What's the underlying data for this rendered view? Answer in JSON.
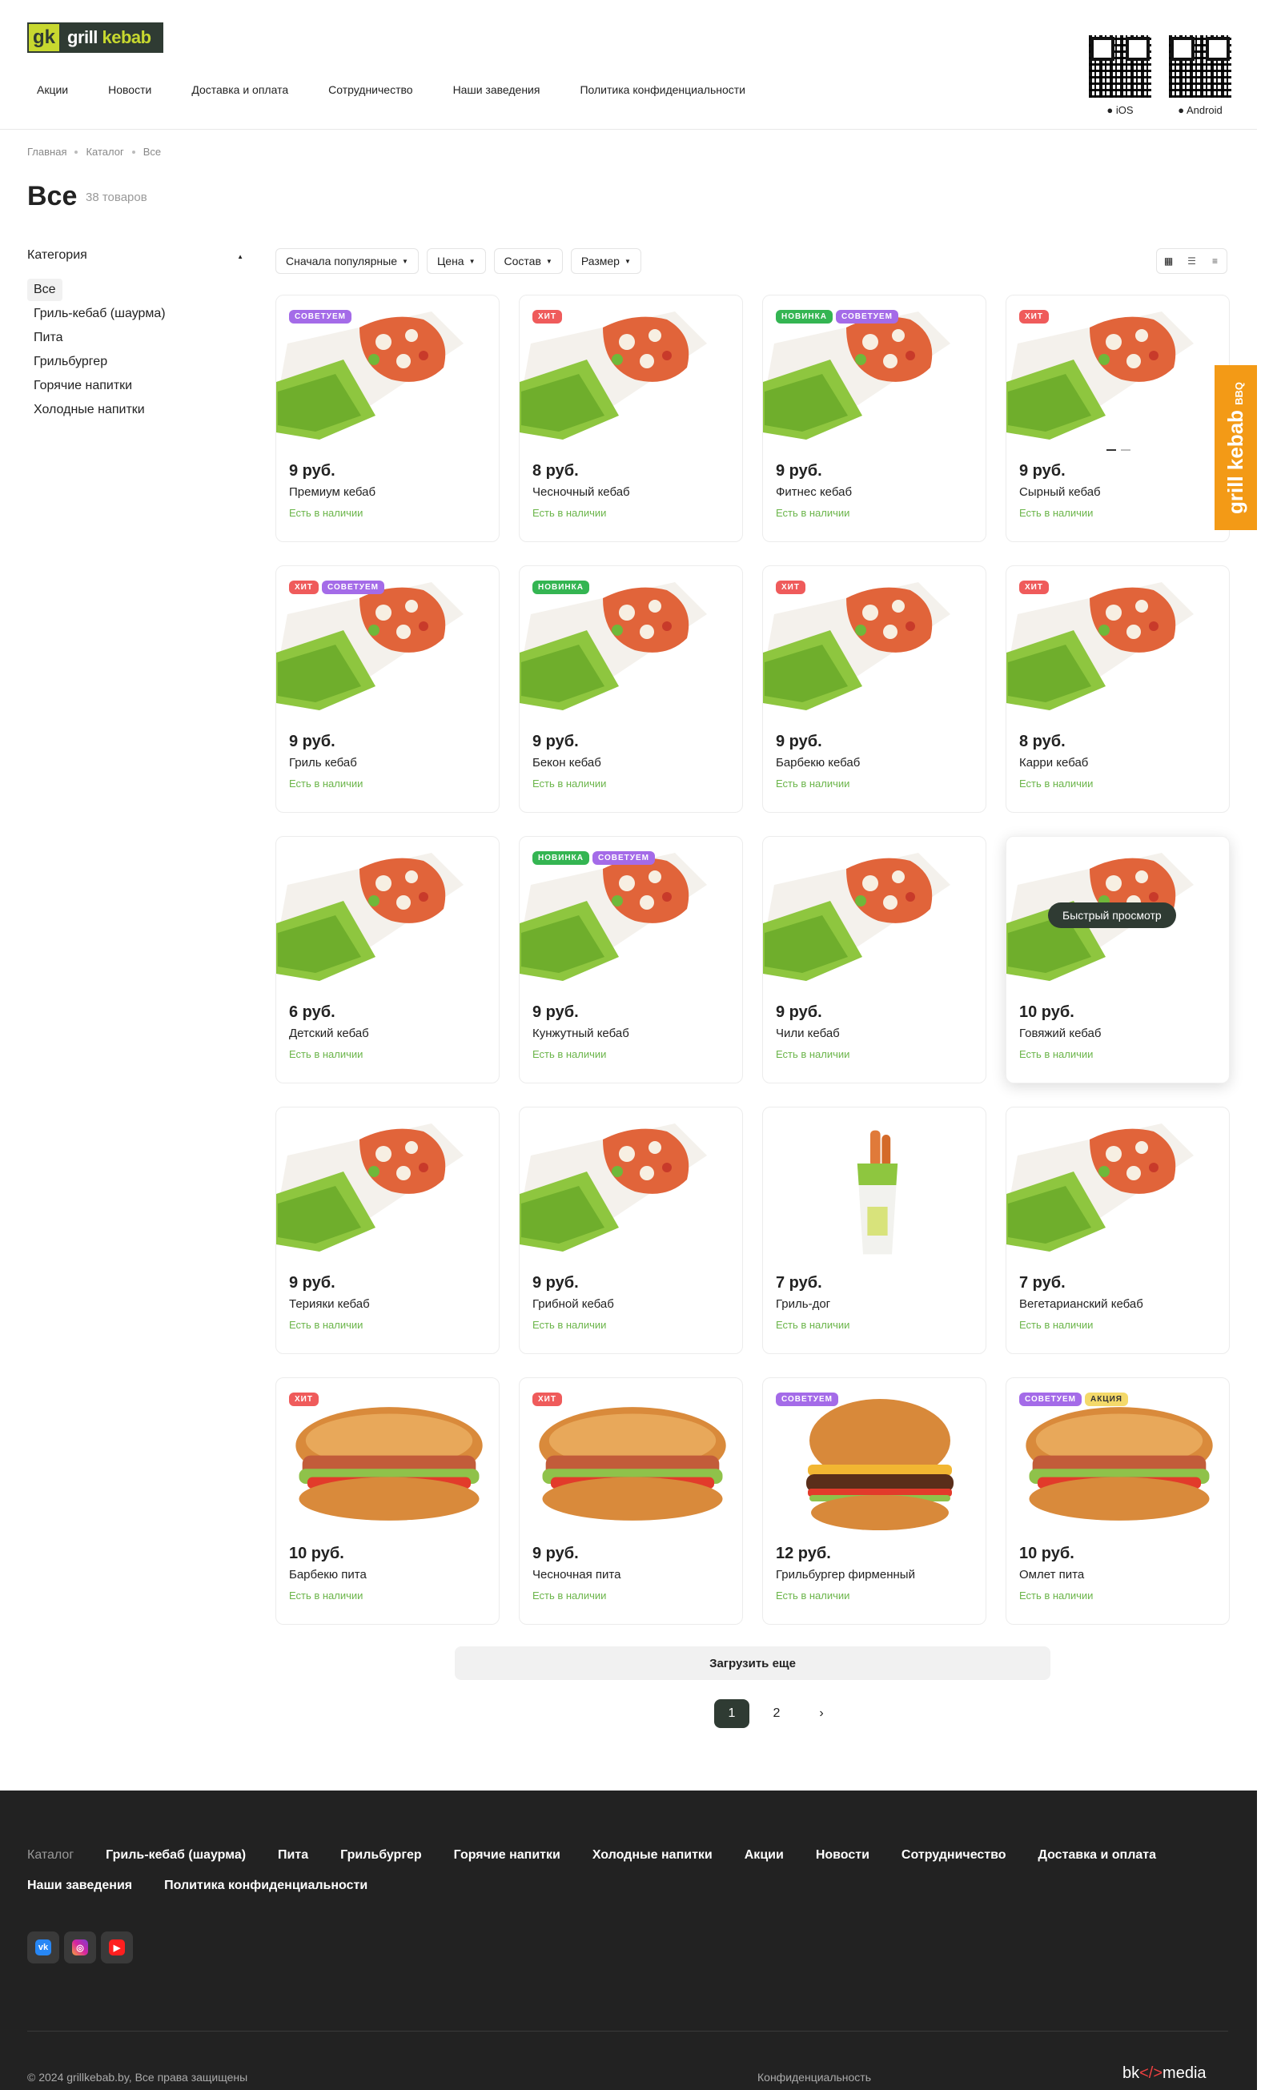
{
  "logo": {
    "short": "gk",
    "text_a": "grill",
    "text_b": "kebab"
  },
  "nav": [
    "Акции",
    "Новости",
    "Доставка и оплата",
    "Сотрудничество",
    "Наши заведения",
    "Политика конфиденциальности"
  ],
  "apps": {
    "ios": "iOS",
    "android": "Android"
  },
  "breadcrumbs": [
    "Главная",
    "Каталог",
    "Все"
  ],
  "page": {
    "title": "Все",
    "count": "38 товаров"
  },
  "sidebar": {
    "heading": "Категория",
    "items": [
      "Все",
      "Гриль-кебаб (шаурма)",
      "Пита",
      "Грильбургер",
      "Горячие напитки",
      "Холодные напитки"
    ],
    "active_index": 0
  },
  "filters": [
    "Сначала популярные",
    "Цена",
    "Состав",
    "Размер"
  ],
  "badge_labels": {
    "hit": "ХИТ",
    "rec": "СОВЕТУЕМ",
    "new": "НОВИНКА",
    "sale": "АКЦИЯ"
  },
  "availability_text": "Есть в наличии",
  "quick_view": "Быстрый просмотр",
  "side_tab": {
    "main": "grill kebab",
    "sub": "BBQ"
  },
  "products": [
    {
      "price": "9 руб.",
      "name": "Премиум кебаб",
      "badges": [
        "rec"
      ],
      "img": "kebab"
    },
    {
      "price": "8 руб.",
      "name": "Чесночный кебаб",
      "badges": [
        "hit"
      ],
      "img": "kebab"
    },
    {
      "price": "9 руб.",
      "name": "Фитнес кебаб",
      "badges": [
        "new",
        "rec"
      ],
      "img": "kebab"
    },
    {
      "price": "9 руб.",
      "name": "Сырный кебаб",
      "badges": [
        "hit"
      ],
      "img": "kebab"
    },
    {
      "price": "9 руб.",
      "name": "Гриль кебаб",
      "badges": [
        "hit",
        "rec"
      ],
      "img": "kebab"
    },
    {
      "price": "9 руб.",
      "name": "Бекон кебаб",
      "badges": [
        "new"
      ],
      "img": "kebab"
    },
    {
      "price": "9 руб.",
      "name": "Барбекю кебаб",
      "badges": [
        "hit"
      ],
      "img": "kebab"
    },
    {
      "price": "8 руб.",
      "name": "Карри кебаб",
      "badges": [
        "hit"
      ],
      "img": "kebab"
    },
    {
      "price": "6 руб.",
      "name": "Детский кебаб",
      "badges": [],
      "img": "kebab"
    },
    {
      "price": "9 руб.",
      "name": "Кунжутный кебаб",
      "badges": [
        "new",
        "rec"
      ],
      "img": "kebab"
    },
    {
      "price": "9 руб.",
      "name": "Чили кебаб",
      "badges": [],
      "img": "kebab"
    },
    {
      "price": "10 руб.",
      "name": "Говяжий кебаб",
      "badges": [],
      "img": "kebab"
    },
    {
      "price": "9 руб.",
      "name": "Терияки кебаб",
      "badges": [],
      "img": "kebab"
    },
    {
      "price": "9 руб.",
      "name": "Грибной кебаб",
      "badges": [],
      "img": "kebab"
    },
    {
      "price": "7 руб.",
      "name": "Гриль-дог",
      "badges": [],
      "img": "hotdog"
    },
    {
      "price": "7 руб.",
      "name": "Вегетарианский кебаб",
      "badges": [],
      "img": "kebab"
    },
    {
      "price": "10 руб.",
      "name": "Барбекю пита",
      "badges": [
        "hit"
      ],
      "img": "pita"
    },
    {
      "price": "9 руб.",
      "name": "Чесночная пита",
      "badges": [
        "hit"
      ],
      "img": "pita"
    },
    {
      "price": "12 руб.",
      "name": "Грильбургер фирменный",
      "badges": [
        "rec"
      ],
      "img": "burger"
    },
    {
      "price": "10 руб.",
      "name": "Омлет пита",
      "badges": [
        "rec",
        "sale"
      ],
      "img": "pita"
    }
  ],
  "load_more": "Загрузить еще",
  "pagination": {
    "pages": [
      "1",
      "2"
    ],
    "current": "1",
    "next": "›"
  },
  "footer": {
    "nav": [
      "Каталог",
      "Гриль-кебаб (шаурма)",
      "Пита",
      "Грильбургер",
      "Горячие напитки",
      "Холодные напитки",
      "Акции",
      "Новости",
      "Сотрудничество",
      "Доставка и оплата",
      "Наши заведения",
      "Политика конфиденциальности"
    ],
    "social": [
      "vk-icon",
      "instagram-icon",
      "youtube-icon"
    ],
    "copyright": "© 2024 grillkebab.by, Все права защищены",
    "privacy": "Конфиденциальность",
    "dev_a": "bk",
    "dev_mark": "</>",
    "dev_b": "media"
  },
  "colors": {
    "brand_dark": "#2f3b33",
    "brand_lime": "#c7d82f",
    "hit": "#ef5b5b",
    "rec": "#a46be8",
    "new": "#34b552",
    "sale": "#f4d96a",
    "available": "#6bb54a",
    "bbq_tab": "#f39a16"
  }
}
